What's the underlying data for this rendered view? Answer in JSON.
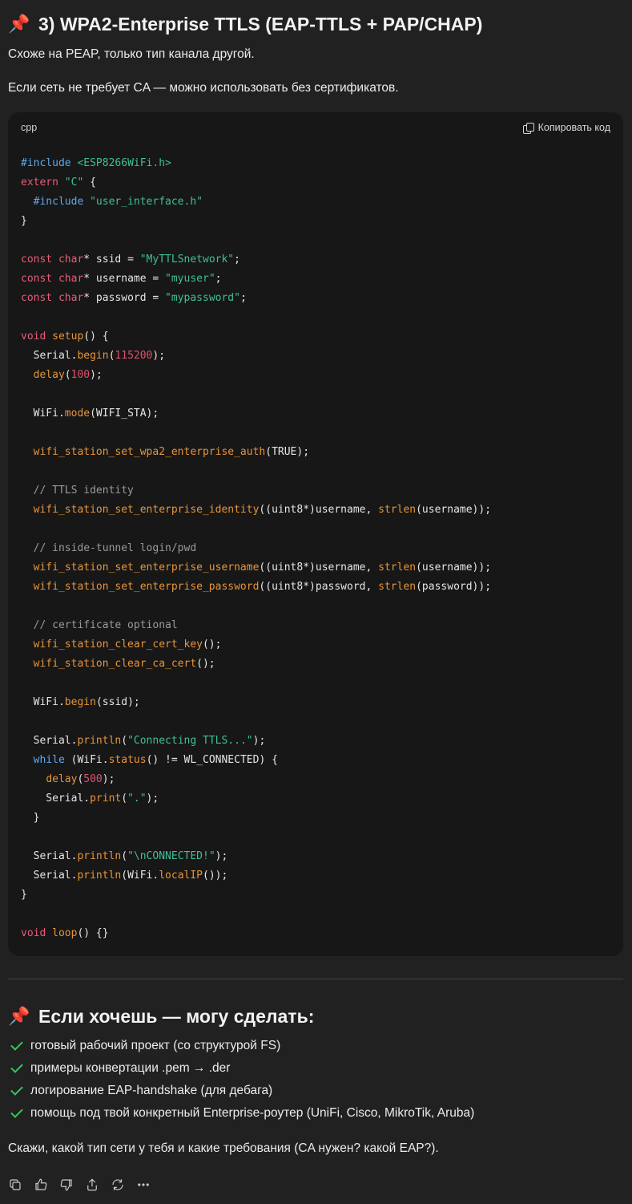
{
  "heading": {
    "pin": "📌",
    "title": "3) WPA2-Enterprise TTLS (EAP-TTLS + PAP/CHAP)"
  },
  "intro": [
    "Схоже на PEAP, только тип канала другой.",
    "Если сеть не требует CA — можно использовать без сертификатов."
  ],
  "code": {
    "language": "cpp",
    "copy_label": "Копировать код",
    "lines": [
      "#include <ESP8266WiFi.h>",
      "extern \"C\" {",
      "  #include \"user_interface.h\"",
      "}",
      "",
      "const char* ssid = \"MyTTLSnetwork\";",
      "const char* username = \"myuser\";",
      "const char* password = \"mypassword\";",
      "",
      "void setup() {",
      "  Serial.begin(115200);",
      "  delay(100);",
      "",
      "  WiFi.mode(WIFI_STA);",
      "",
      "  wifi_station_set_wpa2_enterprise_auth(TRUE);",
      "",
      "  // TTLS identity",
      "  wifi_station_set_enterprise_identity((uint8*)username, strlen(username));",
      "",
      "  // inside-tunnel login/pwd",
      "  wifi_station_set_enterprise_username((uint8*)username, strlen(username));",
      "  wifi_station_set_enterprise_password((uint8*)password, strlen(password));",
      "",
      "  // certificate optional",
      "  wifi_station_clear_cert_key();",
      "  wifi_station_clear_ca_cert();",
      "",
      "  WiFi.begin(ssid);",
      "",
      "  Serial.println(\"Connecting TTLS...\");",
      "  while (WiFi.status() != WL_CONNECTED) {",
      "    delay(500);",
      "    Serial.print(\".\");",
      "  }",
      "",
      "  Serial.println(\"\\nCONNECTED!\");",
      "  Serial.println(WiFi.localIP());",
      "}",
      "",
      "void loop() {}"
    ]
  },
  "offer": {
    "pin": "📌",
    "title": "Если хочешь — могу сделать:",
    "items": [
      "готовый рабочий проект (со структурой FS)",
      "примеры конвертации .pem → .der",
      "логирование EAP-handshake (для дебага)",
      "помощь под твой конкретный Enterprise-роутер (UniFi, Cisco, MikroTik, Aruba)"
    ]
  },
  "closing": "Скажи, какой тип сети у тебя и какие требования (CA нужен? какой EAP?).",
  "actions": [
    "copy-icon",
    "thumbs-up-icon",
    "thumbs-down-icon",
    "share-icon",
    "regenerate-icon",
    "more-icon"
  ],
  "colors": {
    "background": "#212121",
    "code_bg": "#171717",
    "keyword": "#e85c7a",
    "string": "#3fbf9a",
    "function": "#e8943a",
    "comment": "#9a9a9a",
    "check": "#34c759"
  }
}
